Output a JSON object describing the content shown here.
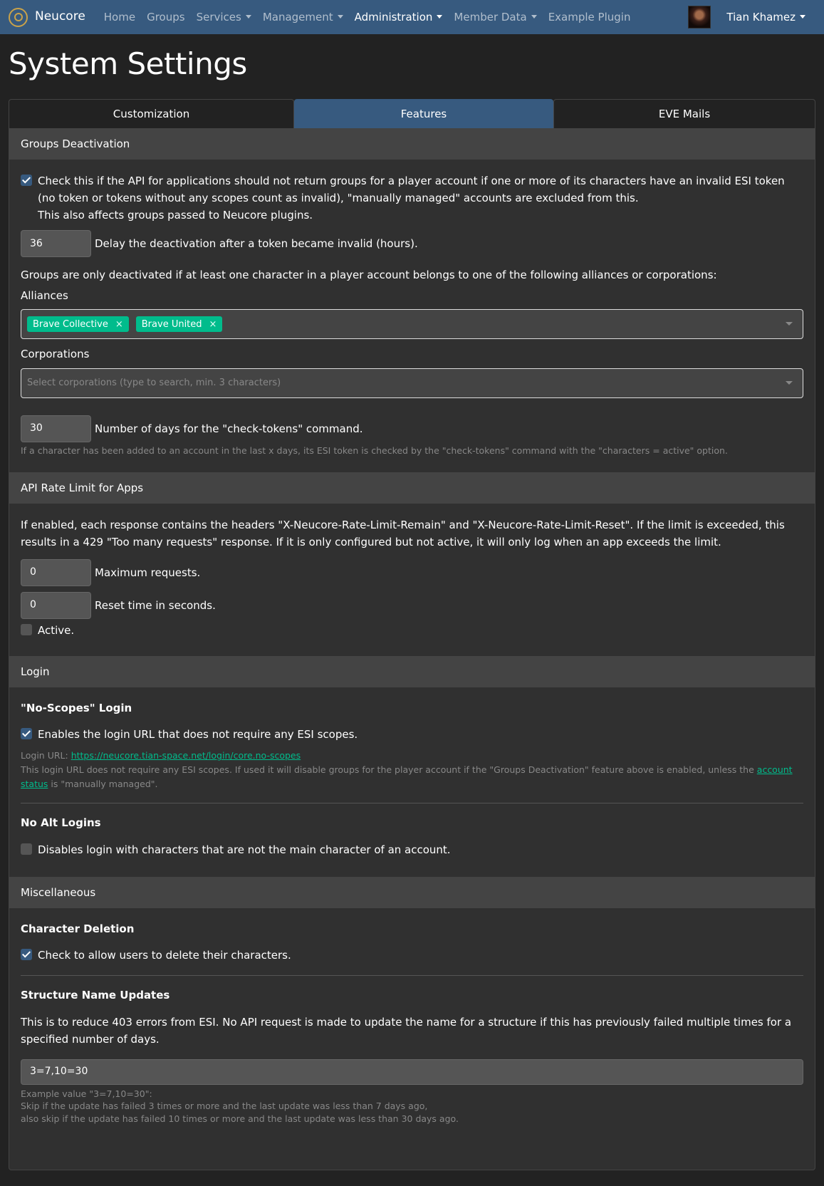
{
  "nav": {
    "brand": "Neucore",
    "items": [
      {
        "label": "Home",
        "dropdown": false
      },
      {
        "label": "Groups",
        "dropdown": false
      },
      {
        "label": "Services",
        "dropdown": true
      },
      {
        "label": "Management",
        "dropdown": true
      },
      {
        "label": "Administration",
        "dropdown": true
      },
      {
        "label": "Member Data",
        "dropdown": true
      },
      {
        "label": "Example Plugin",
        "dropdown": false
      }
    ],
    "user": "Tian Khamez"
  },
  "page_title": "System Settings",
  "tabs": [
    "Customization",
    "Features",
    "EVE Mails"
  ],
  "groups_deactivation": {
    "header": "Groups Deactivation",
    "check_text_1": "Check this if the API for applications should not return groups for a player account if one or more of its characters have an invalid ESI token (no token or tokens without any scopes count as invalid), \"manually managed\" accounts are excluded from this.",
    "check_text_2": "This also affects groups passed to Neucore plugins.",
    "delay_value": "36",
    "delay_label": "Delay the deactivation after a token became invalid (hours).",
    "info": "Groups are only deactivated if at least one character in a player account belongs to one of the following alliances or corporations:",
    "alliances_label": "Alliances",
    "alliances": [
      "Brave Collective",
      "Brave United"
    ],
    "corporations_label": "Corporations",
    "corporations_placeholder": "Select corporations (type to search, min. 3 characters)",
    "days_value": "30",
    "days_label": "Number of days for the \"check-tokens\" command.",
    "days_help": "If a character has been added to an account in the last x days, its ESI token is checked by the \"check-tokens\" command with the \"characters = active\" option."
  },
  "rate_limit": {
    "header": "API Rate Limit for Apps",
    "description": "If enabled, each response contains the headers \"X-Neucore-Rate-Limit-Remain\" and \"X-Neucore-Rate-Limit-Reset\". If the limit is exceeded, this results in a 429 \"Too many requests\" response. If it is only configured but not active, it will only log when an app exceeds the limit.",
    "max_value": "0",
    "max_label": "Maximum requests.",
    "reset_value": "0",
    "reset_label": "Reset time in seconds.",
    "active_label": "Active."
  },
  "login": {
    "header": "Login",
    "no_scopes_title": "\"No-Scopes\" Login",
    "no_scopes_check": "Enables the login URL that does not require any ESI scopes.",
    "login_url_prefix": "Login URL:",
    "login_url": "https://neucore.tian-space.net/login/core.no-scopes",
    "help_1": "This login URL does not require any ESI scopes. If used it will disable groups for the player account if the \"Groups Deactivation\" feature above is enabled, unless the",
    "help_link": "account status",
    "help_2": "is \"manually managed\".",
    "no_alt_title": "No Alt Logins",
    "no_alt_check": "Disables login with characters that are not the main character of an account."
  },
  "misc": {
    "header": "Miscellaneous",
    "char_del_title": "Character Deletion",
    "char_del_check": "Check to allow users to delete their characters.",
    "struct_title": "Structure Name Updates",
    "struct_desc": "This is to reduce 403 errors from ESI. No API request is made to update the name for a structure if this has previously failed multiple times for a specified number of days.",
    "struct_value": "3=7,10=30",
    "help_1": "Example value \"3=7,10=30\":",
    "help_2": "Skip if the update has failed 3 times or more and the last update was less than 7 days ago,",
    "help_3": "also skip if the update has failed 10 times or more and the last update was less than 30 days ago."
  },
  "colors": {
    "navbar": "#375a7f",
    "accent": "#00bc8c",
    "background": "#222222",
    "card": "#303030",
    "card_header": "#444444"
  }
}
